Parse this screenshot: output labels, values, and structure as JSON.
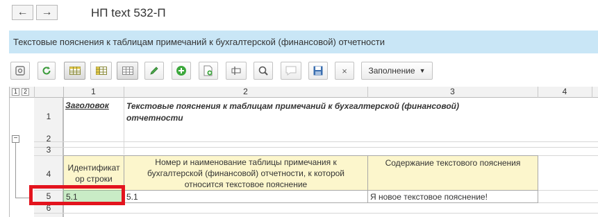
{
  "window": {
    "title": "НП text 532-П"
  },
  "nav": {
    "back_icon": "←",
    "forward_icon": "→"
  },
  "banner": {
    "text": "Текстовые пояснения к таблицам примечаний к бухгалтерской (финансовой) отчетности"
  },
  "toolbar": {
    "fill_label": "Заполнение",
    "delete_icon": "×"
  },
  "sheet": {
    "group_levels": [
      "1",
      "2"
    ],
    "columns": [
      "1",
      "2",
      "3",
      "4"
    ],
    "rows": [
      "1",
      "2",
      "3",
      "4",
      "5",
      "6"
    ],
    "heading_label": "Заголовок",
    "heading_text": "Текстовые пояснения к таблицам примечаний к бухгалтерской (финансовой) отчетности",
    "col_header_1": "Идентификатор строки",
    "col_header_1_line1": "Идентификат",
    "col_header_1_line2": "ор строки",
    "col_header_2_line1": "Номер и наименование таблицы примечания к",
    "col_header_2_line2": "бухгалтерской (финансовой) отчетности, к которой",
    "col_header_2_line3": "относится текстовое пояснение",
    "col_header_3": "Содержание текстового пояснения",
    "row5": {
      "id": "5.1",
      "table_ref": "5.1",
      "text": "Я новое текстовое пояснение!"
    },
    "collapse_icon": "−"
  },
  "colors": {
    "banner": "#c9e6f6",
    "header_yellow": "#fcf6cc",
    "selected_cell": "#c9ecc6",
    "highlight": "#e3141e"
  }
}
